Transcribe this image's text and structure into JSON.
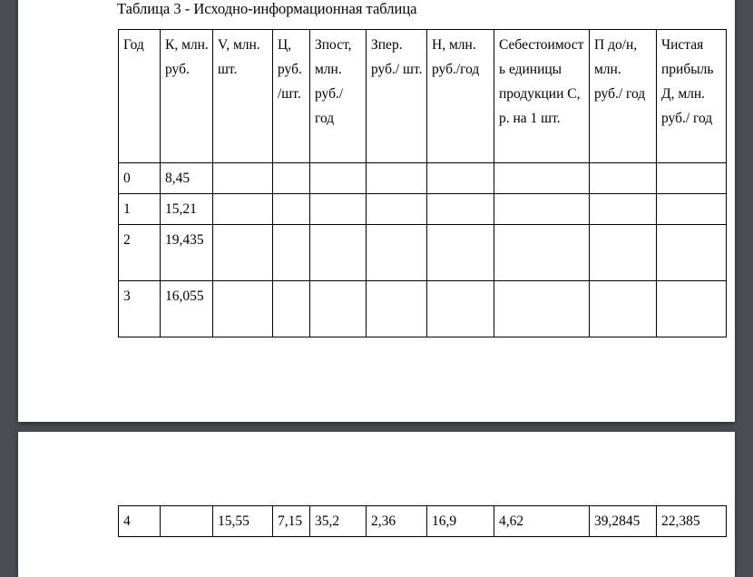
{
  "viewer": {
    "background_color": "#4a4e52",
    "page_background_color": "#ffffff"
  },
  "document": {
    "caption": "Таблица 3 - Исходно-информационная таблица",
    "page_one": {
      "table": {
        "headers": [
          "Год",
          "К, млн. руб.",
          "V, млн. шт.",
          "Ц, руб. /шт.",
          "Зпост, млн. руб./ год",
          "Зпер. руб./ шт.",
          "Н, млн. руб./год",
          "Себестоимость единицы продукции С, р. на 1 шт.",
          "П до/н, млн. руб./ год",
          "Чистая прибыль Д, млн. руб./ год"
        ],
        "rows": [
          [
            "0",
            "8,45",
            "",
            "",
            "",
            "",
            "",
            "",
            "",
            ""
          ],
          [
            "1",
            "15,21",
            "",
            "",
            "",
            "",
            "",
            "",
            "",
            ""
          ],
          [
            "2",
            "19,435",
            "",
            "",
            "",
            "",
            "",
            "",
            "",
            ""
          ],
          [
            "3",
            "16,055",
            "",
            "",
            "",
            "",
            "",
            "",
            "",
            ""
          ]
        ]
      }
    },
    "page_two": {
      "table": {
        "rows": [
          [
            "4",
            "",
            "15,55",
            "7,15",
            "35,2",
            "2,36",
            "16,9",
            "4,62",
            "39,2845",
            "22,385"
          ]
        ]
      }
    }
  }
}
